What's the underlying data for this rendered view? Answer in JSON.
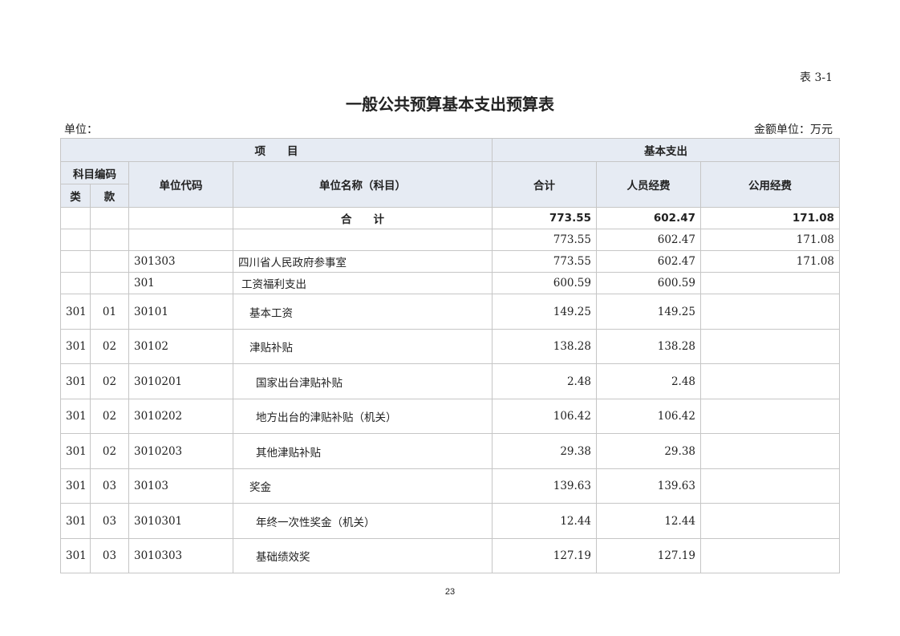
{
  "header": {
    "table_no": "表 3-1",
    "title": "一般公共预算基本支出预算表",
    "unit_label": "单位：",
    "amount_unit": "金额单位：万元"
  },
  "columns": {
    "project": "项　　目",
    "basic_expense": "基本支出",
    "subject_code": "科目编码",
    "category": "类",
    "item": "款",
    "unit_code": "单位代码",
    "unit_name": "单位名称（科目）",
    "total": "合计",
    "personnel": "人员经费",
    "public": "公用经费"
  },
  "total_row": {
    "label": "合　　计",
    "total": "773.55",
    "personnel": "602.47",
    "public": "171.08"
  },
  "rows": [
    {
      "cat": "",
      "item": "",
      "code": "",
      "name": "",
      "total": "773.55",
      "personnel": "602.47",
      "public": "171.08"
    },
    {
      "cat": "",
      "item": "",
      "code": "301303",
      "name": "四川省人民政府参事室",
      "total": "773.55",
      "personnel": "602.47",
      "public": "171.08"
    },
    {
      "cat": "",
      "item": "",
      "code": "301",
      "name": "工资福利支出",
      "total": "600.59",
      "personnel": "600.59",
      "public": ""
    },
    {
      "cat": "301",
      "item": "01",
      "code": "30101",
      "name": "基本工资",
      "total": "149.25",
      "personnel": "149.25",
      "public": ""
    },
    {
      "cat": "301",
      "item": "02",
      "code": "30102",
      "name": "津贴补贴",
      "total": "138.28",
      "personnel": "138.28",
      "public": ""
    },
    {
      "cat": "301",
      "item": "02",
      "code": "3010201",
      "name": "国家出台津贴补贴",
      "total": "2.48",
      "personnel": "2.48",
      "public": ""
    },
    {
      "cat": "301",
      "item": "02",
      "code": "3010202",
      "name": "地方出台的津贴补贴（机关）",
      "total": "106.42",
      "personnel": "106.42",
      "public": ""
    },
    {
      "cat": "301",
      "item": "02",
      "code": "3010203",
      "name": "其他津贴补贴",
      "total": "29.38",
      "personnel": "29.38",
      "public": ""
    },
    {
      "cat": "301",
      "item": "03",
      "code": "30103",
      "name": "奖金",
      "total": "139.63",
      "personnel": "139.63",
      "public": ""
    },
    {
      "cat": "301",
      "item": "03",
      "code": "3010301",
      "name": "年终一次性奖金（机关）",
      "total": "12.44",
      "personnel": "12.44",
      "public": ""
    },
    {
      "cat": "301",
      "item": "03",
      "code": "3010303",
      "name": "基础绩效奖",
      "total": "127.19",
      "personnel": "127.19",
      "public": ""
    }
  ],
  "footer": {
    "page_number": "23"
  }
}
